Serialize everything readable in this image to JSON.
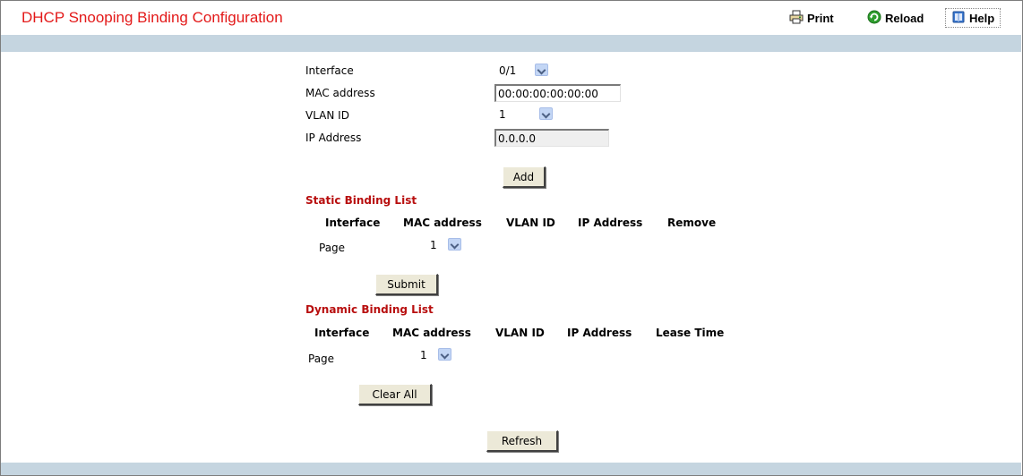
{
  "header": {
    "title": "DHCP Snooping Binding Configuration",
    "print_label": "Print",
    "reload_label": "Reload",
    "help_label": "Help"
  },
  "form": {
    "interface": {
      "label": "Interface",
      "value": "0/1"
    },
    "mac": {
      "label": "MAC address",
      "value": "00:00:00:00:00:00"
    },
    "vlan": {
      "label": "VLAN ID",
      "value": "1"
    },
    "ip": {
      "label": "IP Address",
      "value": "0.0.0.0"
    },
    "add_label": "Add"
  },
  "static_list": {
    "title": "Static Binding List",
    "columns": [
      "Interface",
      "MAC address",
      "VLAN ID",
      "IP Address",
      "Remove"
    ],
    "page_label": "Page",
    "page_value": "1",
    "submit_label": "Submit"
  },
  "dynamic_list": {
    "title": "Dynamic Binding List",
    "columns": [
      "Interface",
      "MAC address",
      "VLAN ID",
      "IP Address",
      "Lease Time"
    ],
    "page_label": "Page",
    "page_value": "1",
    "clear_label": "Clear All"
  },
  "refresh_label": "Refresh",
  "colors": {
    "title": "#e31919",
    "section": "#b80f0f",
    "band": "#c5d5e0"
  }
}
